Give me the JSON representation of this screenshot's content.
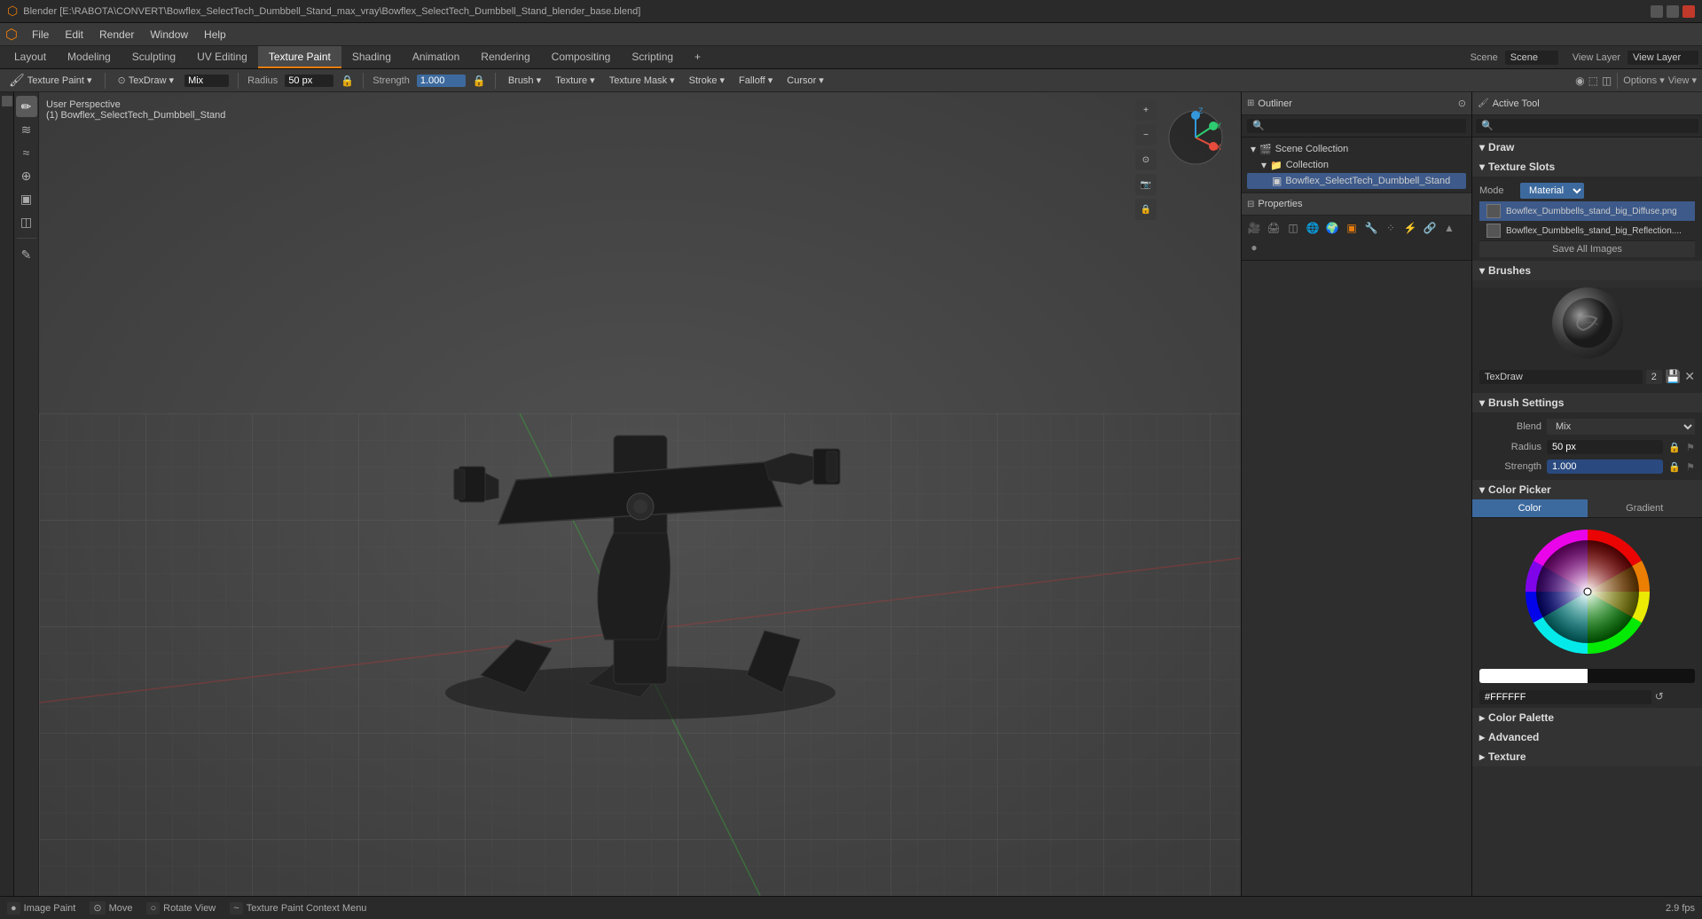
{
  "title_bar": {
    "title": "Blender [E:\\RABOTA\\CONVERT\\Bowflex_SelectTech_Dumbbell_Stand_max_vray\\Bowflex_SelectTech_Dumbbell_Stand_blender_base.blend]",
    "icons": [
      "minimize",
      "maximize",
      "close"
    ]
  },
  "menu_bar": {
    "items": [
      "Blender",
      "File",
      "Edit",
      "Render",
      "Window",
      "Help"
    ],
    "layout_items": [
      "Layout",
      "Modeling",
      "Sculpting",
      "UV Editing",
      "Texture Paint",
      "Shading",
      "Animation",
      "Rendering",
      "Compositing",
      "Scripting",
      "+"
    ]
  },
  "workspace_tabs": {
    "tabs": [
      "Layout",
      "Modeling",
      "Sculpting",
      "UV Editing",
      "Texture Paint",
      "Shading",
      "Animation",
      "Rendering",
      "Compositing",
      "Scripting",
      "+"
    ],
    "active": "Texture Paint",
    "right": {
      "scene_label": "Scene",
      "view_layer_label": "View Layer"
    }
  },
  "tool_header": {
    "draw_mode": "TexDraw",
    "blend_label": "Mix",
    "radius_label": "Radius",
    "radius_value": "50 px",
    "strength_label": "Strength",
    "strength_value": "1.000",
    "brush_label": "Brush",
    "texture_label": "Texture",
    "texture_mask_label": "Texture Mask",
    "stroke_label": "Stroke",
    "falloff_label": "Falloff",
    "cursor_label": "Cursor",
    "mode_label": "Texture Paint",
    "view_label": "View"
  },
  "viewport": {
    "perspective": "User Perspective",
    "object": "(1) Bowflex_SelectTech_Dumbbell_Stand"
  },
  "outliner": {
    "title": "Scene Collection",
    "collection": "Collection",
    "items": [
      {
        "name": "Bowflex_SelectTech_Dumbbell_Stand",
        "selected": true
      }
    ]
  },
  "properties_sidebar": {
    "draw_label": "Draw",
    "texture_slots_label": "Texture Slots",
    "mode_label": "Mode",
    "mode_value": "Material",
    "slots": [
      {
        "name": "Bowflex_Dumbbells_stand_big_Diffuse.png",
        "selected": true
      },
      {
        "name": "Bowflex_Dumbbells_stand_big_Reflection...."
      }
    ],
    "save_images_label": "Save All Images",
    "brushes_label": "Brushes",
    "brush_name": "TexDraw",
    "brush_number": "2",
    "brush_settings_label": "Brush Settings",
    "blend_label": "Blend",
    "blend_value": "Mix",
    "radius_label": "Radius",
    "radius_value": "50 px",
    "strength_label": "Strength",
    "strength_value": "1.000",
    "color_picker_label": "Color Picker",
    "color_tab": "Color",
    "gradient_tab": "Gradient",
    "color_palette_label": "Color Palette",
    "advanced_label": "Advanced",
    "texture_label": "Texture"
  },
  "status_bar": {
    "image_paint": "Image Paint",
    "move": "Move",
    "rotate_view": "Rotate View",
    "texture_paint_context": "Texture Paint Context Menu",
    "fps": "2.9 fps"
  },
  "icons": {
    "draw_icon": "✏",
    "brush_icon": "🖌",
    "smear_icon": "≋",
    "clone_icon": "⊕",
    "fill_icon": "▣",
    "erase_icon": "◻",
    "snap_icon": "⊙",
    "search_icon": "🔍",
    "plus_icon": "+",
    "arrow_down": "▾",
    "arrow_right": "▸",
    "chevron_down": "▾"
  }
}
